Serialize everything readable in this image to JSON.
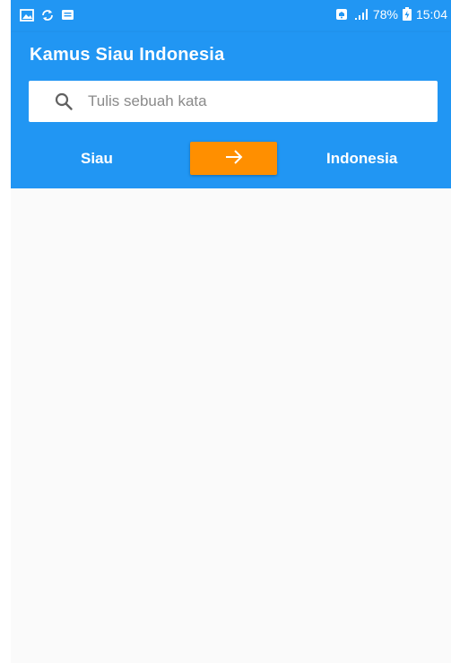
{
  "status_bar": {
    "left_icons": [
      "gallery-icon",
      "sync-icon",
      "message-icon"
    ],
    "battery_percent": "78%",
    "time": "15:04",
    "right_icons": [
      "silent-mode-icon",
      "signal-icon",
      "battery-icon"
    ]
  },
  "app_bar": {
    "title": "Kamus Siau Indonesia",
    "color": "#2196f3"
  },
  "search": {
    "placeholder": "Tulis sebuah kata",
    "value": "",
    "icon": "search-icon"
  },
  "language_switch": {
    "source": "Siau",
    "target": "Indonesia",
    "swap_icon": "arrow-right-icon",
    "swap_color": "#ff8f00"
  }
}
